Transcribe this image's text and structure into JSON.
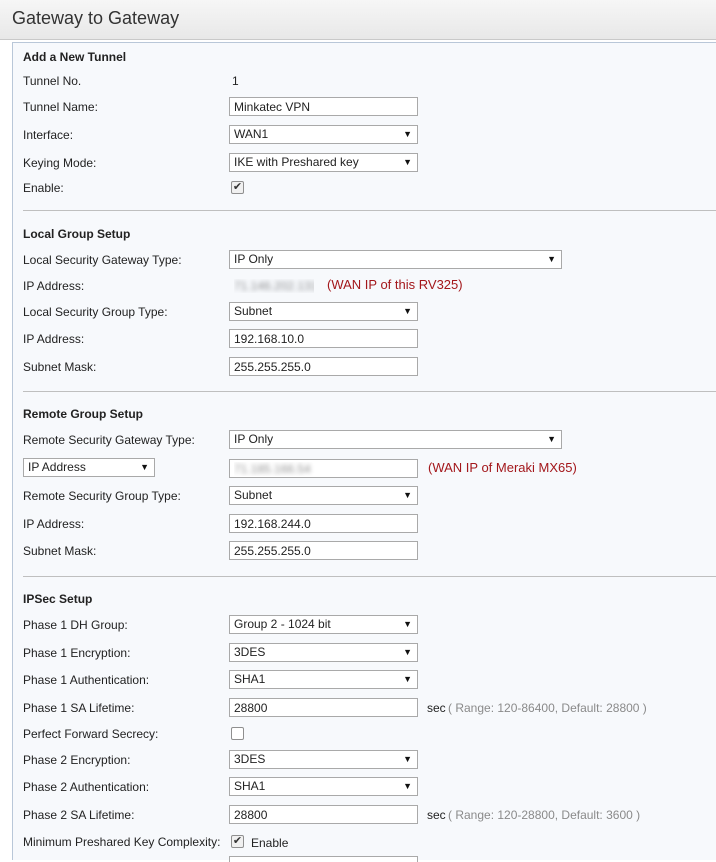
{
  "page": {
    "title": "Gateway to Gateway"
  },
  "add_tunnel": {
    "section_title": "Add a New Tunnel",
    "tunnel_no_label": "Tunnel No.",
    "tunnel_no_value": "1",
    "tunnel_name_label": "Tunnel Name:",
    "tunnel_name_value": "Minkatec VPN",
    "interface_label": "Interface:",
    "interface_value": "WAN1",
    "keying_mode_label": "Keying Mode:",
    "keying_mode_value": "IKE with Preshared key",
    "enable_label": "Enable:",
    "enable_checked": true
  },
  "local_group": {
    "section_title": "Local Group Setup",
    "gateway_type_label": "Local Security Gateway Type:",
    "gateway_type_value": "IP Only",
    "ip_label": "IP Address:",
    "ip_value_obscured": "71.146.202.131",
    "ip_note": "(WAN IP of this RV325)",
    "group_type_label": "Local Security Group Type:",
    "group_type_value": "Subnet",
    "group_ip_label": "IP Address:",
    "group_ip_value": "192.168.10.0",
    "subnet_label": "Subnet Mask:",
    "subnet_value": "255.255.255.0"
  },
  "remote_group": {
    "section_title": "Remote Group Setup",
    "gateway_type_label": "Remote Security Gateway Type:",
    "gateway_type_value": "IP Only",
    "address_type_value": "IP Address",
    "ip_value_obscured": "71.185.166.54",
    "ip_note": "(WAN IP of Meraki MX65)",
    "group_type_label": "Remote Security Group Type:",
    "group_type_value": "Subnet",
    "group_ip_label": "IP Address:",
    "group_ip_value": "192.168.244.0",
    "subnet_label": "Subnet Mask:",
    "subnet_value": "255.255.255.0"
  },
  "ipsec": {
    "section_title": "IPSec Setup",
    "p1_dh_label": "Phase 1 DH Group:",
    "p1_dh_value": "Group 2 - 1024 bit",
    "p1_enc_label": "Phase 1 Encryption:",
    "p1_enc_value": "3DES",
    "p1_auth_label": "Phase 1 Authentication:",
    "p1_auth_value": "SHA1",
    "p1_life_label": "Phase 1 SA Lifetime:",
    "p1_life_value": "28800",
    "p1_life_unit": "sec",
    "p1_life_hint": "( Range: 120-86400, Default: 28800 )",
    "pfs_label": "Perfect Forward Secrecy:",
    "pfs_checked": false,
    "p2_enc_label": "Phase 2 Encryption:",
    "p2_enc_value": "3DES",
    "p2_auth_label": "Phase 2 Authentication:",
    "p2_auth_value": "SHA1",
    "p2_life_label": "Phase 2 SA Lifetime:",
    "p2_life_value": "28800",
    "p2_life_unit": "sec",
    "p2_life_hint": "( Range: 120-28800, Default: 3600 )",
    "min_psk_label": "Minimum Preshared Key Complexity:",
    "min_psk_checked": true,
    "min_psk_enable_text": "Enable"
  },
  "icons": {
    "dropdown": "chevron-down-icon",
    "check": "checkmark-icon"
  },
  "colors": {
    "note_red": "#a3171b",
    "hint_gray": "#8a8a8a"
  },
  "glyphs": {
    "arrow": "▼",
    "check": "✔"
  }
}
